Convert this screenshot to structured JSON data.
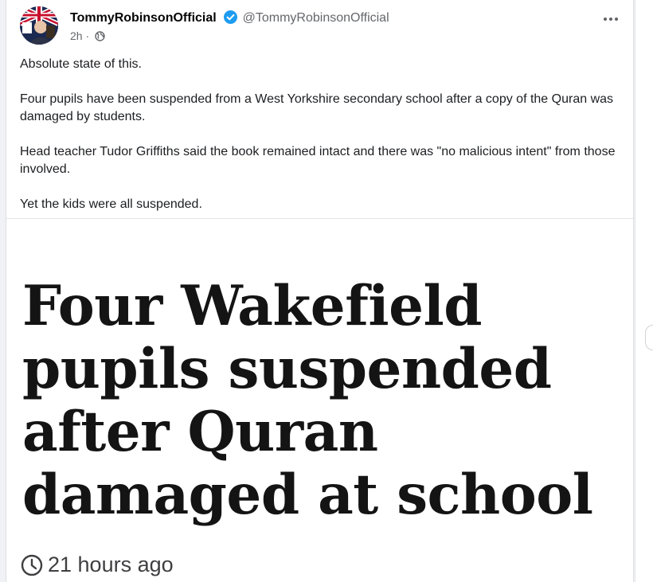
{
  "post": {
    "author_name": "TommyRobinsonOfficial",
    "author_handle": "@TommyRobinsonOfficial",
    "timestamp": "2h",
    "separator": "·",
    "audience_icon": "globe-icon",
    "verified_icon": "verified-badge-icon",
    "menu_icon": "more-options-icon",
    "paragraphs": [
      "Absolute state of this.",
      "Four pupils have been suspended from a West Yorkshire secondary school after a copy of the Quran was damaged by students.",
      "Head teacher Tudor Griffiths said the book remained intact and there was \"no malicious intent\" from those involved.",
      "Yet the kids were all suspended."
    ]
  },
  "article": {
    "headline": "Four Wakefield pupils suspended after Quran damaged at school",
    "published": "21 hours ago",
    "time_icon": "clock-icon"
  },
  "colors": {
    "verified_blue": "#1d9bf0",
    "text_primary": "#050505",
    "text_secondary": "#65676b",
    "headline": "#141414"
  }
}
